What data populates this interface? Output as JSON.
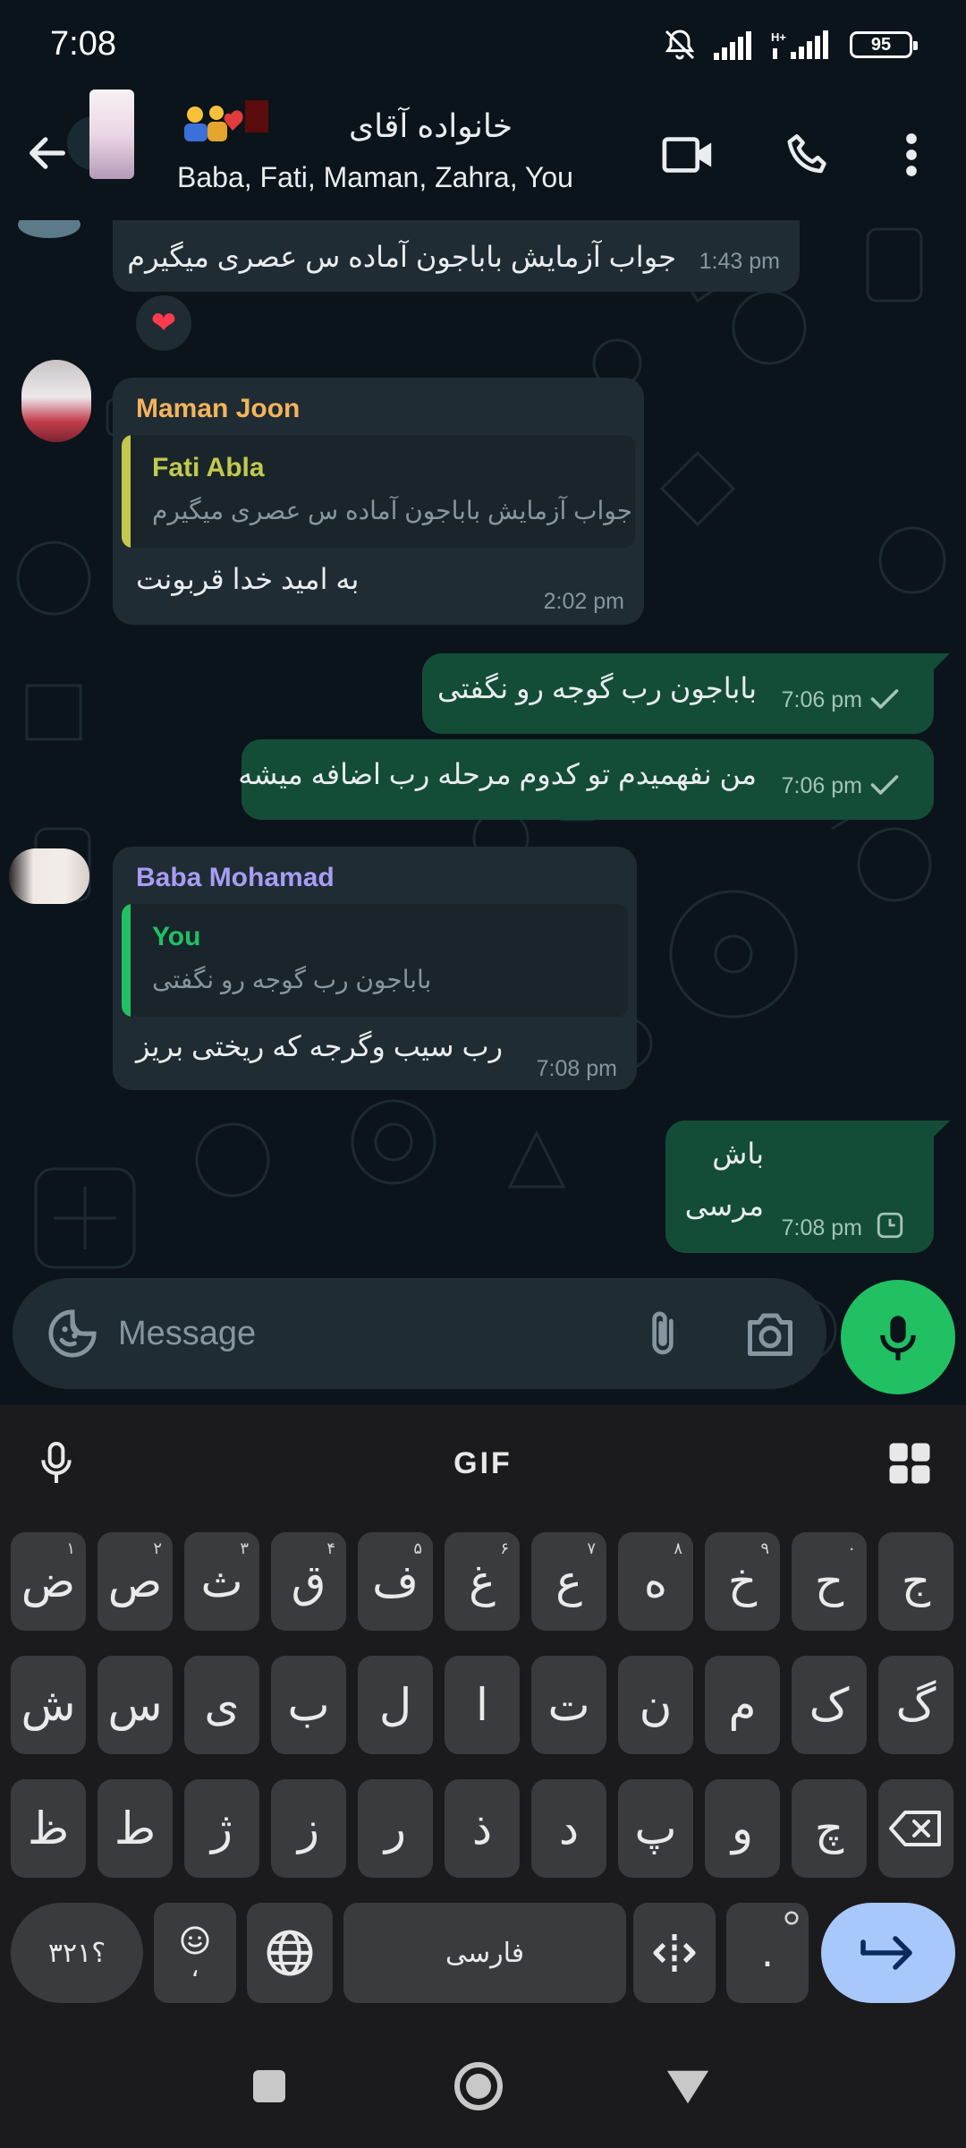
{
  "status_bar": {
    "time": "7:08",
    "battery": "95"
  },
  "header": {
    "title": "خانواده آقای",
    "members": "Baba, Fati, Maman, Zahra, You"
  },
  "messages": [
    {
      "text": "جواب آزمایش باباجون آماده س عصری میگیرم",
      "time": "1:43 pm",
      "reaction": "❤"
    },
    {
      "sender": "Maman Joon",
      "quote_author": "Fati Abla",
      "quote_text": "جواب آزمایش باباجون آماده س عصری میگیرم",
      "text": "به امید خدا قربونت",
      "time": "2:02 pm"
    },
    {
      "text": "باباجون رب گوجه رو نگفتی",
      "time": "7:06 pm"
    },
    {
      "text": "من نفهمیدم تو کدوم مرحله رب اضافه میشه",
      "time": "7:06 pm"
    },
    {
      "sender": "Baba Mohamad",
      "quote_author": "You",
      "quote_text": "باباجون رب گوجه رو نگفتی",
      "text": "رب سیب وگرجه که ریختی بریز",
      "time": "7:08 pm"
    },
    {
      "line1": "باش",
      "line2": "مرسی",
      "time": "7:08 pm"
    }
  ],
  "composer": {
    "placeholder": "Message"
  },
  "keyboard": {
    "gif_label": "GIF",
    "row1": [
      {
        "k": "ض",
        "h": "۱"
      },
      {
        "k": "ص",
        "h": "۲"
      },
      {
        "k": "ث",
        "h": "۳"
      },
      {
        "k": "ق",
        "h": "۴"
      },
      {
        "k": "ف",
        "h": "۵"
      },
      {
        "k": "غ",
        "h": "۶"
      },
      {
        "k": "ع",
        "h": "۷"
      },
      {
        "k": "ه",
        "h": "۸"
      },
      {
        "k": "خ",
        "h": "۹"
      },
      {
        "k": "ح",
        "h": "۰"
      },
      {
        "k": "ج",
        "h": ""
      }
    ],
    "row2": [
      "ش",
      "س",
      "ی",
      "ب",
      "ل",
      "ا",
      "ت",
      "ن",
      "م",
      "ک",
      "گ"
    ],
    "row3": [
      "ظ",
      "ط",
      "ژ",
      "ز",
      "ر",
      "ذ",
      "د",
      "پ",
      "و",
      "چ"
    ],
    "symbols_key": "؟۳۲۱",
    "emoji_key_sub": "،",
    "space_label": "فارسی",
    "period_key": "."
  },
  "colors": {
    "maman_name": "#f5b35b",
    "fati_quote": "#c3c94d",
    "baba_name": "#a99cf5",
    "you_quote": "#21c063",
    "outgoing_bubble": "#144d37",
    "incoming_bubble": "#1f2c33",
    "send_accent": "#21c063"
  }
}
